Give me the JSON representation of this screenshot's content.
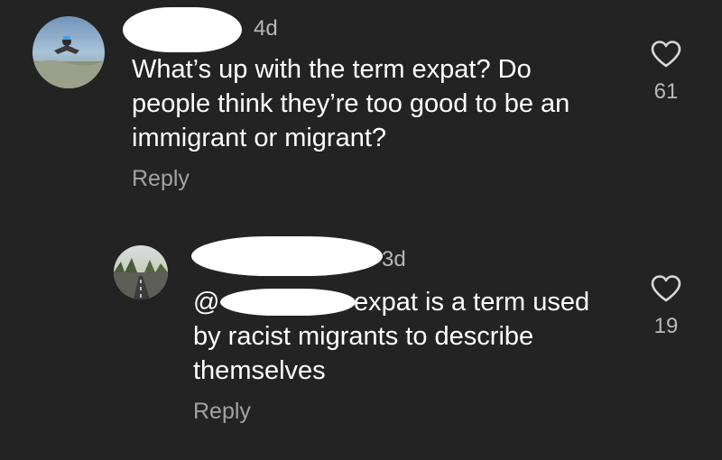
{
  "comment": {
    "time": "4d",
    "text_lines": [
      "What’s up with the term expat? Do",
      "people think they’re too good to be an",
      "immigrant or migrant?"
    ],
    "reply_label": "Reply",
    "like_count": "61",
    "like_icon": "heart-outline-icon"
  },
  "reply": {
    "time": "3d",
    "mention_prefix": "@",
    "text_first_line_rest": "expat is a term used",
    "text_lines_rest": [
      "by racist migrants to describe",
      "themselves"
    ],
    "reply_label": "Reply",
    "like_count": "19",
    "like_icon": "heart-outline-icon"
  },
  "colors": {
    "background": "#232323",
    "text_primary": "#ffffff",
    "text_secondary": "#b8b8b8",
    "redaction": "#ffffff"
  }
}
